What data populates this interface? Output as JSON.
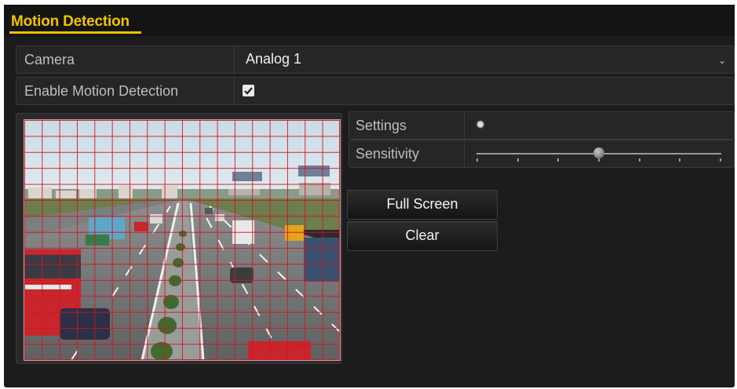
{
  "header": {
    "title": "Motion Detection"
  },
  "camera": {
    "label": "Camera",
    "value": "Analog 1",
    "dropdown_icon": "chevron-down-icon"
  },
  "enable": {
    "label": "Enable Motion Detection",
    "checked": true
  },
  "settings": {
    "label": "Settings",
    "icon": "gear-icon"
  },
  "sensitivity": {
    "label": "Sensitivity",
    "level": 0.5,
    "ticks": 7
  },
  "buttons": {
    "full_screen": "Full Screen",
    "clear": "Clear"
  },
  "grid": {
    "columns": 18,
    "rows": 15,
    "color": "#d2141e"
  },
  "colors": {
    "accent": "#f2c300",
    "panel": "#1c1c1c"
  }
}
